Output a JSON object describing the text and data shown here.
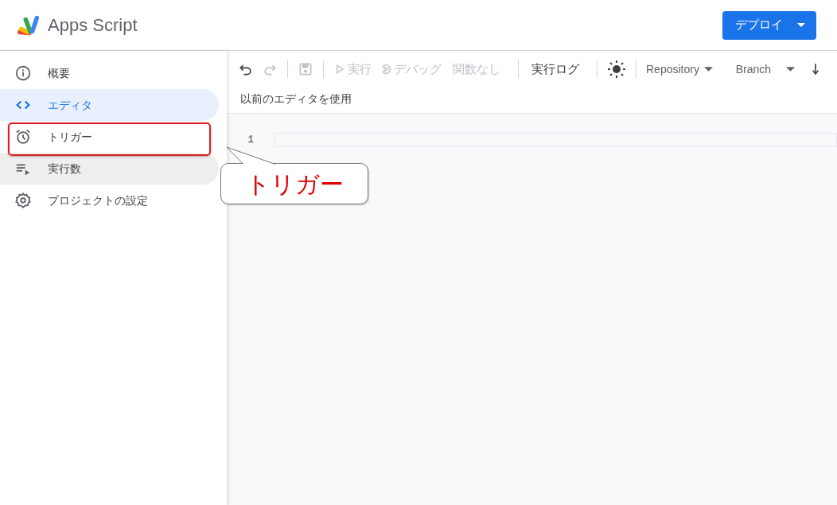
{
  "app": {
    "title": "Apps Script"
  },
  "deploy_button": {
    "label": "デプロイ"
  },
  "sidebar": {
    "items": [
      {
        "kind": "info",
        "label": "概要",
        "selected": false,
        "hovered": false,
        "highlighted": false
      },
      {
        "kind": "code",
        "label": "エディタ",
        "selected": true,
        "hovered": false,
        "highlighted": false
      },
      {
        "kind": "alarm",
        "label": "トリガー",
        "selected": false,
        "hovered": false,
        "highlighted": true
      },
      {
        "kind": "runs",
        "label": "実行数",
        "selected": false,
        "hovered": true,
        "highlighted": false
      },
      {
        "kind": "gear",
        "label": "プロジェクトの設定",
        "selected": false,
        "hovered": false,
        "highlighted": false
      }
    ]
  },
  "toolbar": {
    "items": [
      {
        "kind": "undo",
        "disabled": false
      },
      {
        "kind": "redo",
        "disabled": true
      },
      {
        "kind": "divider"
      },
      {
        "kind": "save",
        "disabled": true
      },
      {
        "kind": "divider"
      },
      {
        "kind": "run",
        "label": "実行",
        "disabled": true
      },
      {
        "kind": "debug",
        "label": "デバッグ",
        "disabled": true
      },
      {
        "kind": "text",
        "label": "関数なし",
        "disabled": true
      },
      {
        "kind": "divider"
      },
      {
        "kind": "text",
        "label": "実行ログ",
        "disabled": false
      },
      {
        "kind": "divider"
      },
      {
        "kind": "theme",
        "disabled": false
      },
      {
        "kind": "divider"
      },
      {
        "kind": "dropdown",
        "label": "Repository",
        "disabled": false
      },
      {
        "kind": "dropdown",
        "label": "Branch",
        "disabled": false
      },
      {
        "kind": "download",
        "disabled": false
      }
    ],
    "legacy_link": "以前のエディタを使用"
  },
  "editor": {
    "line_numbers": [
      "1"
    ]
  },
  "callout": {
    "text": "トリガー"
  }
}
